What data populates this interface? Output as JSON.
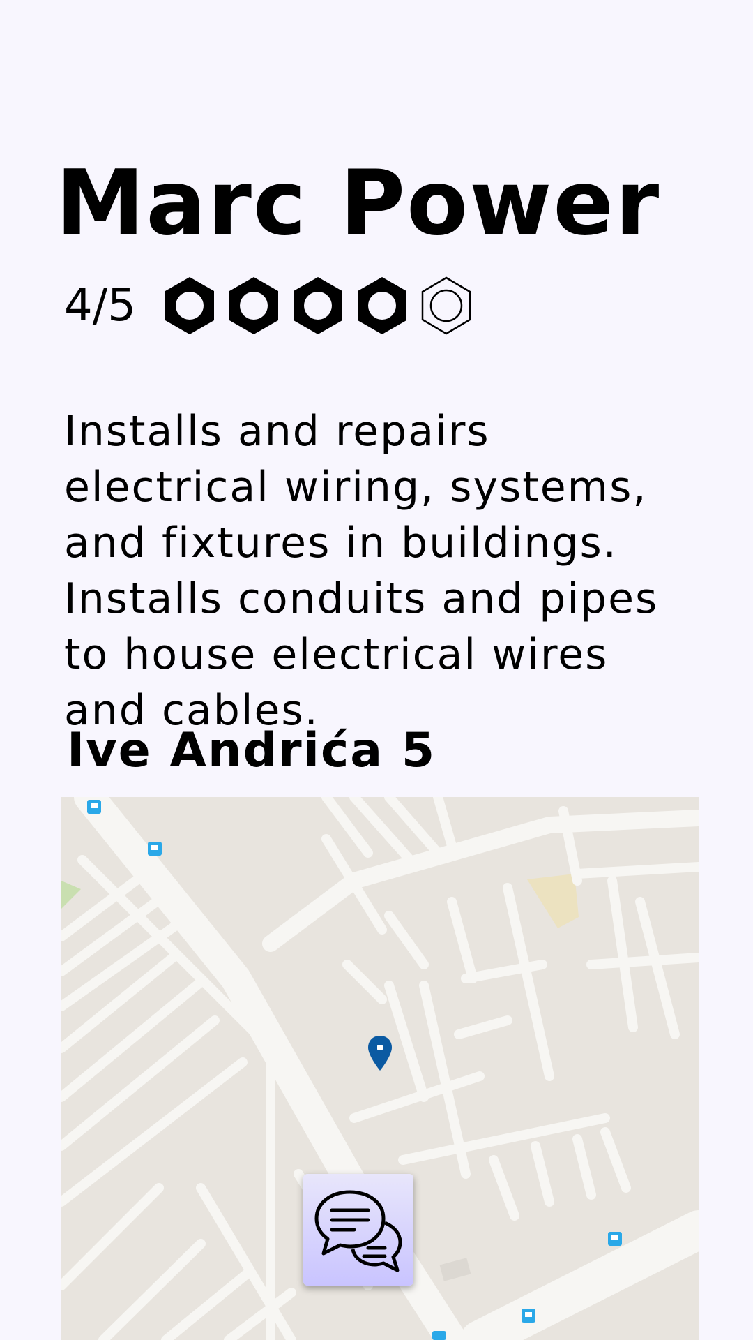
{
  "profile": {
    "name": "Marc Power",
    "rating_text": "4/5",
    "rating": 4,
    "rating_max": 5,
    "rating_icon": "hex-nut-icon",
    "description": "Installs and repairs electrical wiring, systems, and fixtures in buildings. Installs conduits and pipes to house electrical wires and cables.",
    "address": "Ive Andrića 5"
  },
  "map": {
    "marker_icon": "location-pin-icon",
    "transit_icon": "bus-stop-icon",
    "marker_color": "#0b5aa2"
  },
  "chat_button": {
    "icon": "chat-bubbles-icon",
    "background": "#cfcaff"
  }
}
